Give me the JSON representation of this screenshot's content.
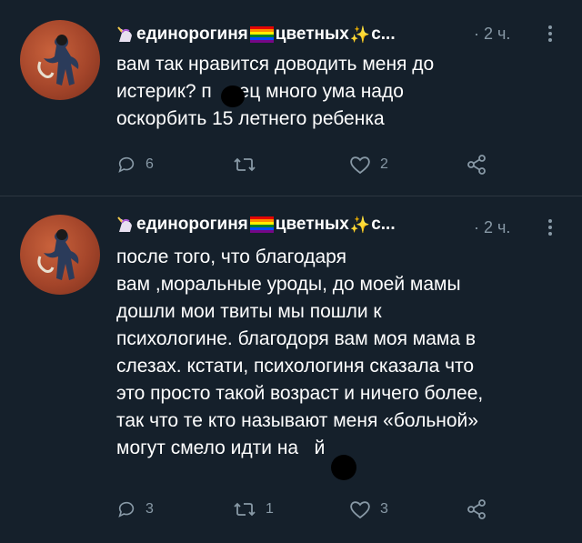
{
  "tweets": [
    {
      "display_name": "единорогиня",
      "name_part2": "цветных",
      "name_part3": "с...",
      "time": "· 2 ч.",
      "text": "вам так нравится доводить меня до\nистерик? п   дец много ума надо\nоскорбить 15 летнего ребенка",
      "counts": {
        "reply": "6",
        "retweet": "",
        "like": "2"
      }
    },
    {
      "display_name": "единорогиня",
      "name_part2": "цветных",
      "name_part3": "с...",
      "time": "· 2 ч.",
      "text": "после того, что благодаря\nвам ,моральные уроды, до моей мамы\nдошли мои твиты мы пошли к\nпсихологине. благодоря вам моя мама в\nслезах. кстати, психологиня сказала что\nэто просто такой возраст и ничего более,\nтак что те кто называют меня «больной»\nмогут смело идти на   й",
      "counts": {
        "reply": "3",
        "retweet": "1",
        "like": "3"
      }
    }
  ],
  "colors": {
    "background": "#15202b",
    "text": "#ffffff",
    "muted": "#8899a6",
    "divider": "#2c3640"
  },
  "icons": [
    "unicorn-icon",
    "rainbow-flag-icon",
    "sparkles-icon",
    "more-icon",
    "reply-icon",
    "retweet-icon",
    "like-icon",
    "share-icon"
  ]
}
